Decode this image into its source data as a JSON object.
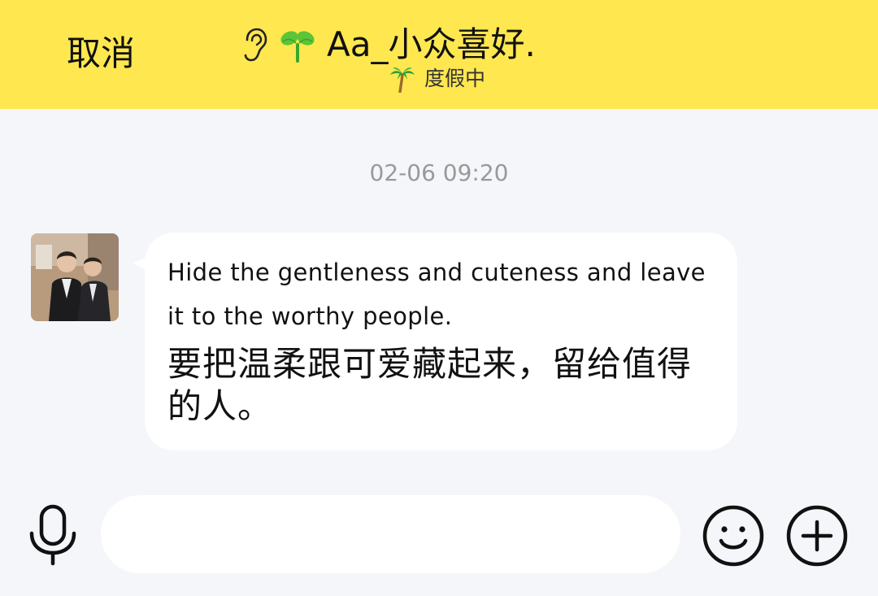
{
  "header": {
    "cancel_label": "取消",
    "contact_name": "Aa_小众喜好.",
    "status_text": "度假中",
    "icons": [
      "ear-icon",
      "sprout-icon",
      "palm-tree-icon"
    ],
    "background_color": "#ffe74f"
  },
  "chat": {
    "timestamp": "02-06 09:20",
    "messages": [
      {
        "sender": "contact",
        "avatar": "avatar-photo",
        "text_en": "Hide the gentleness and cuteness and leave it to the worthy people.",
        "text_zh": "要把温柔跟可爱藏起来，留给值得的人。"
      }
    ]
  },
  "input_bar": {
    "value": "",
    "icons": [
      "microphone-icon",
      "emoji-icon",
      "plus-icon"
    ]
  }
}
